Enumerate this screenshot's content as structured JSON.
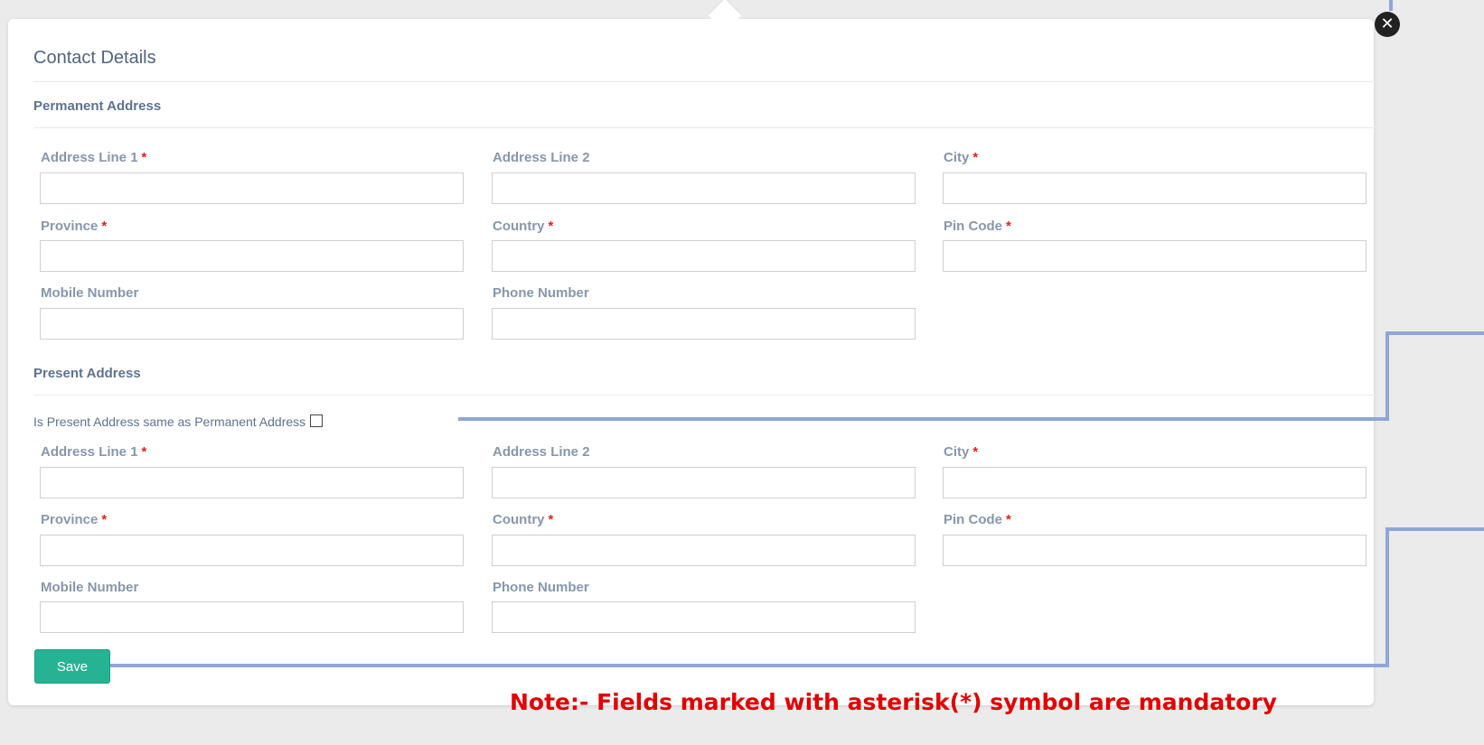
{
  "title": "Contact Details",
  "close_icon": "close-circle-icon",
  "permanent": {
    "heading": "Permanent Address",
    "fields": {
      "address1": {
        "label": "Address Line 1",
        "required": true,
        "value": ""
      },
      "address2": {
        "label": "Address Line 2",
        "required": false,
        "value": ""
      },
      "city": {
        "label": "City",
        "required": true,
        "value": ""
      },
      "province": {
        "label": "Province",
        "required": true,
        "value": ""
      },
      "country": {
        "label": "Country",
        "required": true,
        "value": ""
      },
      "pincode": {
        "label": "Pin Code",
        "required": true,
        "value": ""
      },
      "mobile": {
        "label": "Mobile Number",
        "required": false,
        "value": ""
      },
      "phone": {
        "label": "Phone Number",
        "required": false,
        "value": ""
      }
    }
  },
  "present": {
    "heading": "Present Address",
    "same_as_label": "Is Present Address same as Permanent Address",
    "same_as_checked": false,
    "fields": {
      "address1": {
        "label": "Address Line 1",
        "required": true,
        "value": ""
      },
      "address2": {
        "label": "Address Line 2",
        "required": false,
        "value": ""
      },
      "city": {
        "label": "City",
        "required": true,
        "value": ""
      },
      "province": {
        "label": "Province",
        "required": true,
        "value": ""
      },
      "country": {
        "label": "Country",
        "required": true,
        "value": ""
      },
      "pincode": {
        "label": "Pin Code",
        "required": true,
        "value": ""
      },
      "mobile": {
        "label": "Mobile Number",
        "required": false,
        "value": ""
      },
      "phone": {
        "label": "Phone Number",
        "required": false,
        "value": ""
      }
    }
  },
  "required_marker": "*",
  "save_label": "Save",
  "note": "Note:- Fields marked with asterisk(*) symbol are mandatory",
  "colors": {
    "title": "#4f657f",
    "label": "#8697ab",
    "required": "#e02020",
    "save_button": "#26b394",
    "note": "#e00000",
    "connector": "#8fa7d5"
  }
}
